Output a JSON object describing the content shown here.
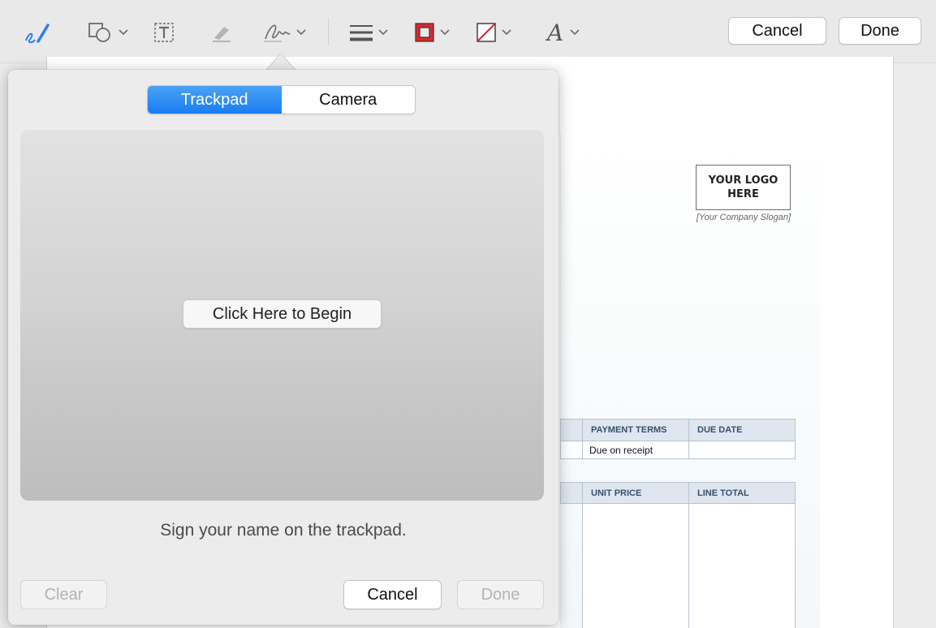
{
  "toolbar": {
    "tools": [
      {
        "name": "sketch-icon",
        "color": "#2f7cf6"
      },
      {
        "name": "shapes-icon"
      },
      {
        "name": "text-icon"
      },
      {
        "name": "highlight-icon"
      },
      {
        "name": "signature-icon"
      },
      {
        "name": "line-style-icon"
      },
      {
        "name": "border-color-icon",
        "color": "#e0262c"
      },
      {
        "name": "fill-color-icon",
        "color": "#e0262c"
      },
      {
        "name": "text-style-icon"
      }
    ],
    "cancel_label": "Cancel",
    "done_label": "Done"
  },
  "document": {
    "logo_text": "YOUR LOGO HERE",
    "slogan": "[Your Company Slogan]",
    "table1": {
      "headers": [
        "PAYMENT TERMS",
        "DUE DATE"
      ],
      "row": [
        "Due on receipt",
        ""
      ]
    },
    "table2": {
      "headers": [
        "UNIT PRICE",
        "LINE TOTAL"
      ]
    }
  },
  "signature_popover": {
    "tabs": [
      {
        "label": "Trackpad",
        "active": true
      },
      {
        "label": "Camera",
        "active": false
      }
    ],
    "begin_label": "Click Here to Begin",
    "instruction": "Sign your name on the trackpad.",
    "clear_label": "Clear",
    "cancel_label": "Cancel",
    "done_label": "Done"
  },
  "colors": {
    "accent": "#1a7cf1",
    "toolbar_bg": "#e9e9e9",
    "popover_bg": "#ececec",
    "table_header_bg": "#dfe6ef"
  }
}
